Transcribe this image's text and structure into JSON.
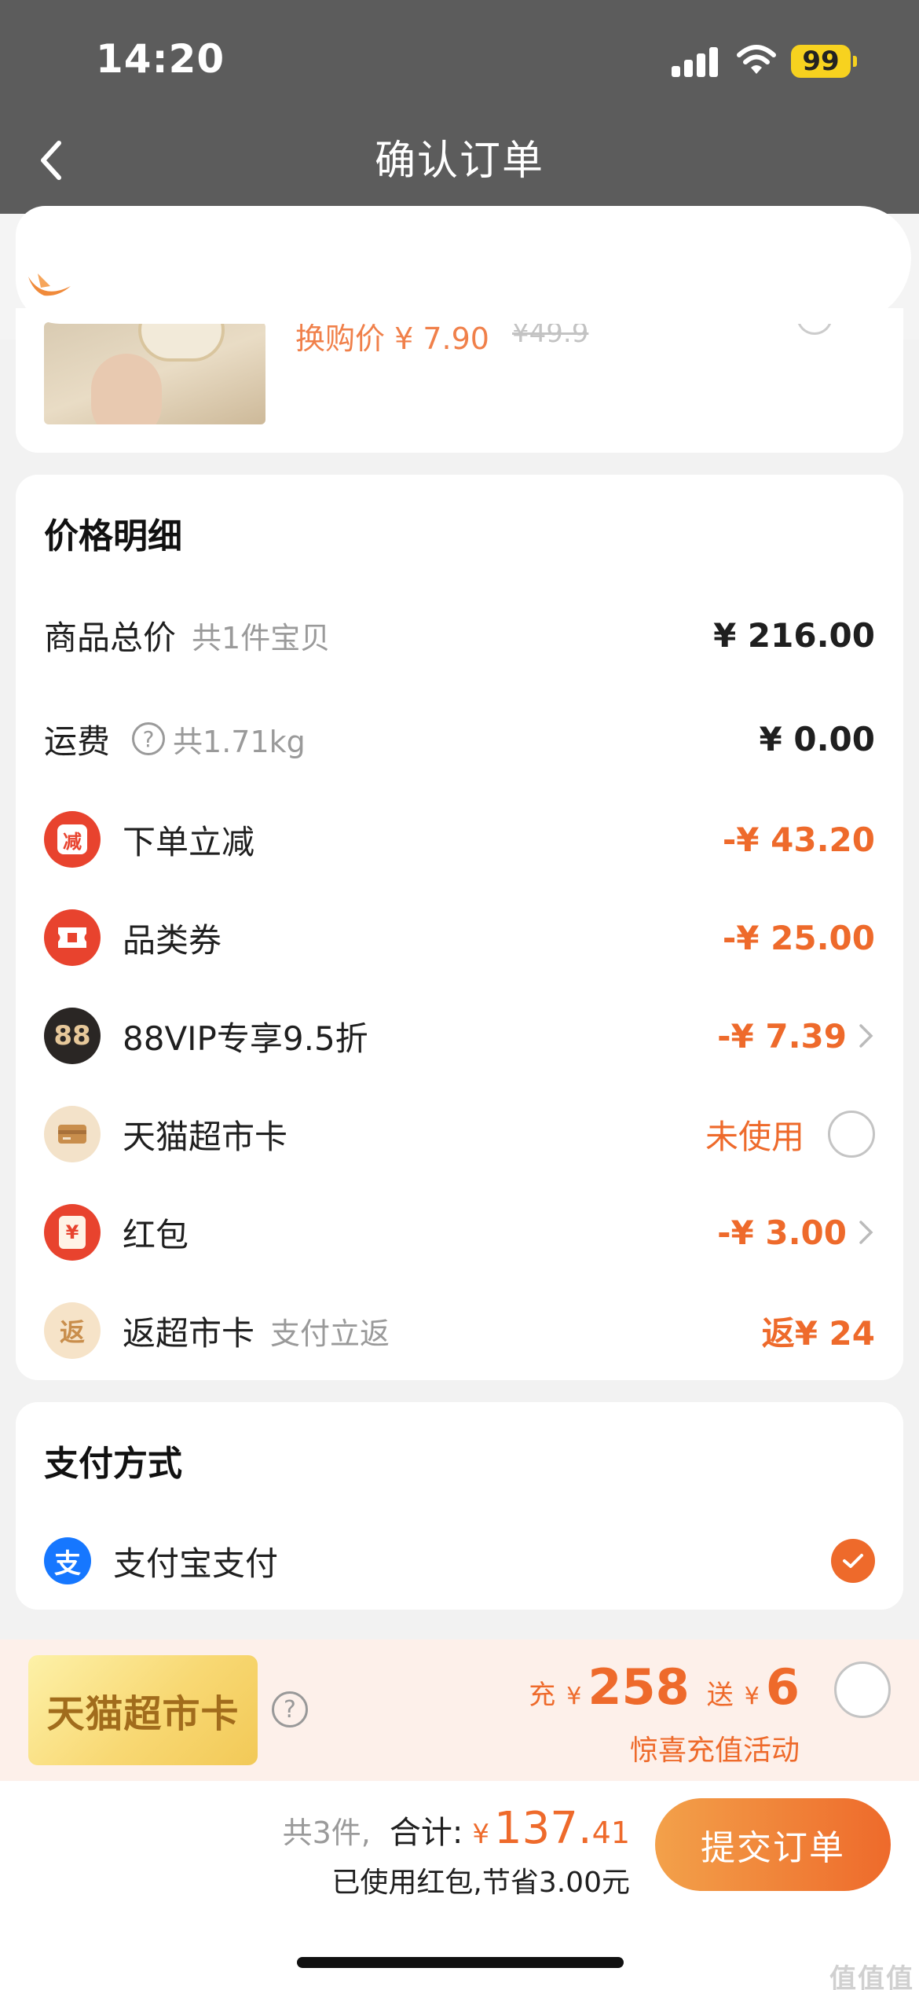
{
  "status_bar": {
    "time": "14:20",
    "battery": "99"
  },
  "nav": {
    "title": "确认订单"
  },
  "product": {
    "price_label": "换购价 ¥ 7.90",
    "original_price": "¥49.9"
  },
  "price_detail": {
    "title": "价格明细",
    "rows": [
      {
        "label": "商品总价",
        "sub": "共1件宝贝",
        "value": "¥ 216.00"
      },
      {
        "label": "运费",
        "sub": "共1.71kg",
        "value": "¥ 0.00"
      },
      {
        "label": "下单立减",
        "value": "-¥ 43.20",
        "icon": "discount-icon",
        "icon_text": "减"
      },
      {
        "label": "品类券",
        "value": "-¥ 25.00",
        "icon": "coupon-icon"
      },
      {
        "label": "88VIP专享9.5折",
        "value": "-¥ 7.39",
        "icon": "vip-88-icon",
        "icon_text": "88"
      },
      {
        "label": "天猫超市卡",
        "value": "未使用",
        "icon": "market-card-icon"
      },
      {
        "label": "红包",
        "value": "-¥ 3.00",
        "icon": "red-packet-icon",
        "icon_text": "¥"
      },
      {
        "label": "返超市卡",
        "sub": "支付立返",
        "value": "返¥ 24",
        "icon": "return-icon",
        "icon_text": "返"
      }
    ]
  },
  "payment": {
    "title": "支付方式",
    "method": "支付宝支付",
    "icon_text": "支"
  },
  "promo": {
    "card_text": "天猫超市卡",
    "charge_label": "充",
    "charge_amount": "258",
    "bonus_label": "送",
    "bonus_amount": "6",
    "currency": "¥",
    "caption": "惊喜充值活动"
  },
  "checkout": {
    "count": "共3件,",
    "total_label": "合计:",
    "currency": "¥",
    "total_int": "137.",
    "total_dec": "41",
    "saved": "已使用红包,节省3.00元",
    "submit": "提交订单"
  },
  "watermark": "值值值",
  "colors": {
    "accent": "#ee6a2b",
    "nav_bg": "#5c5c5c",
    "battery": "#f7d21f",
    "vip": "#2a2624",
    "alipay": "#1677ff"
  }
}
